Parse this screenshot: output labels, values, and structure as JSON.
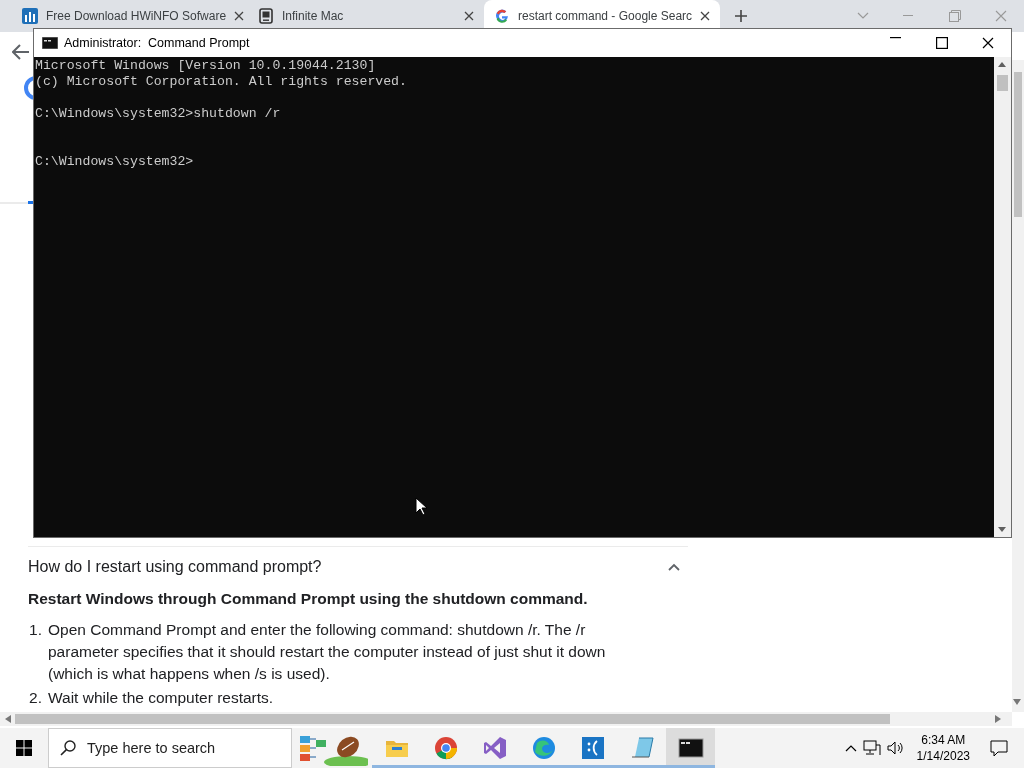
{
  "browser": {
    "tabs": [
      {
        "title": "Free Download HWiNFO Sofware",
        "selected": false,
        "kind": "bars"
      },
      {
        "title": "Infinite Mac",
        "selected": false,
        "kind": "mac"
      },
      {
        "title": "restart command - Google Searc",
        "selected": true,
        "kind": "google"
      }
    ],
    "page": {
      "faq": {
        "question": "How do I restart using command prompt?",
        "expanded": true,
        "answer_title": "Restart Windows through Command Prompt using the shutdown command.",
        "steps": [
          {
            "number": "1.",
            "text": "Open Command Prompt and enter the following command: shutdown /r. The /r parameter specifies that it should restart the computer instead of just shut it down (which is what happens when /s is used)."
          },
          {
            "number": "2.",
            "text": "Wait while the computer restarts."
          }
        ]
      }
    }
  },
  "console": {
    "title": "Administrator:  Command Prompt",
    "blocks": [
      {
        "kind": "banner",
        "lines": [
          "Microsoft Windows [Version 10.0.19044.2130]",
          "(c) Microsoft Corporation. All rights reserved."
        ]
      },
      {
        "kind": "command",
        "lines": [
          "C:\\Windows\\system32>shutdown /r"
        ]
      },
      {
        "kind": "prompt",
        "lines": [
          "C:\\Windows\\system32>"
        ]
      }
    ]
  },
  "taskbar": {
    "search_placeholder": "Type here to search",
    "apps": [
      {
        "kind": "explorer",
        "running": true,
        "selected": false
      },
      {
        "kind": "chrome",
        "running": true,
        "selected": false
      },
      {
        "kind": "vs",
        "running": true,
        "selected": false
      },
      {
        "kind": "edge",
        "running": true,
        "selected": false
      },
      {
        "kind": "sad",
        "running": true,
        "selected": false
      },
      {
        "kind": "notepad",
        "running": true,
        "selected": false
      },
      {
        "kind": "cmd",
        "running": true,
        "selected": true
      }
    ],
    "time": "6:34 AM",
    "date": "1/14/2023"
  }
}
